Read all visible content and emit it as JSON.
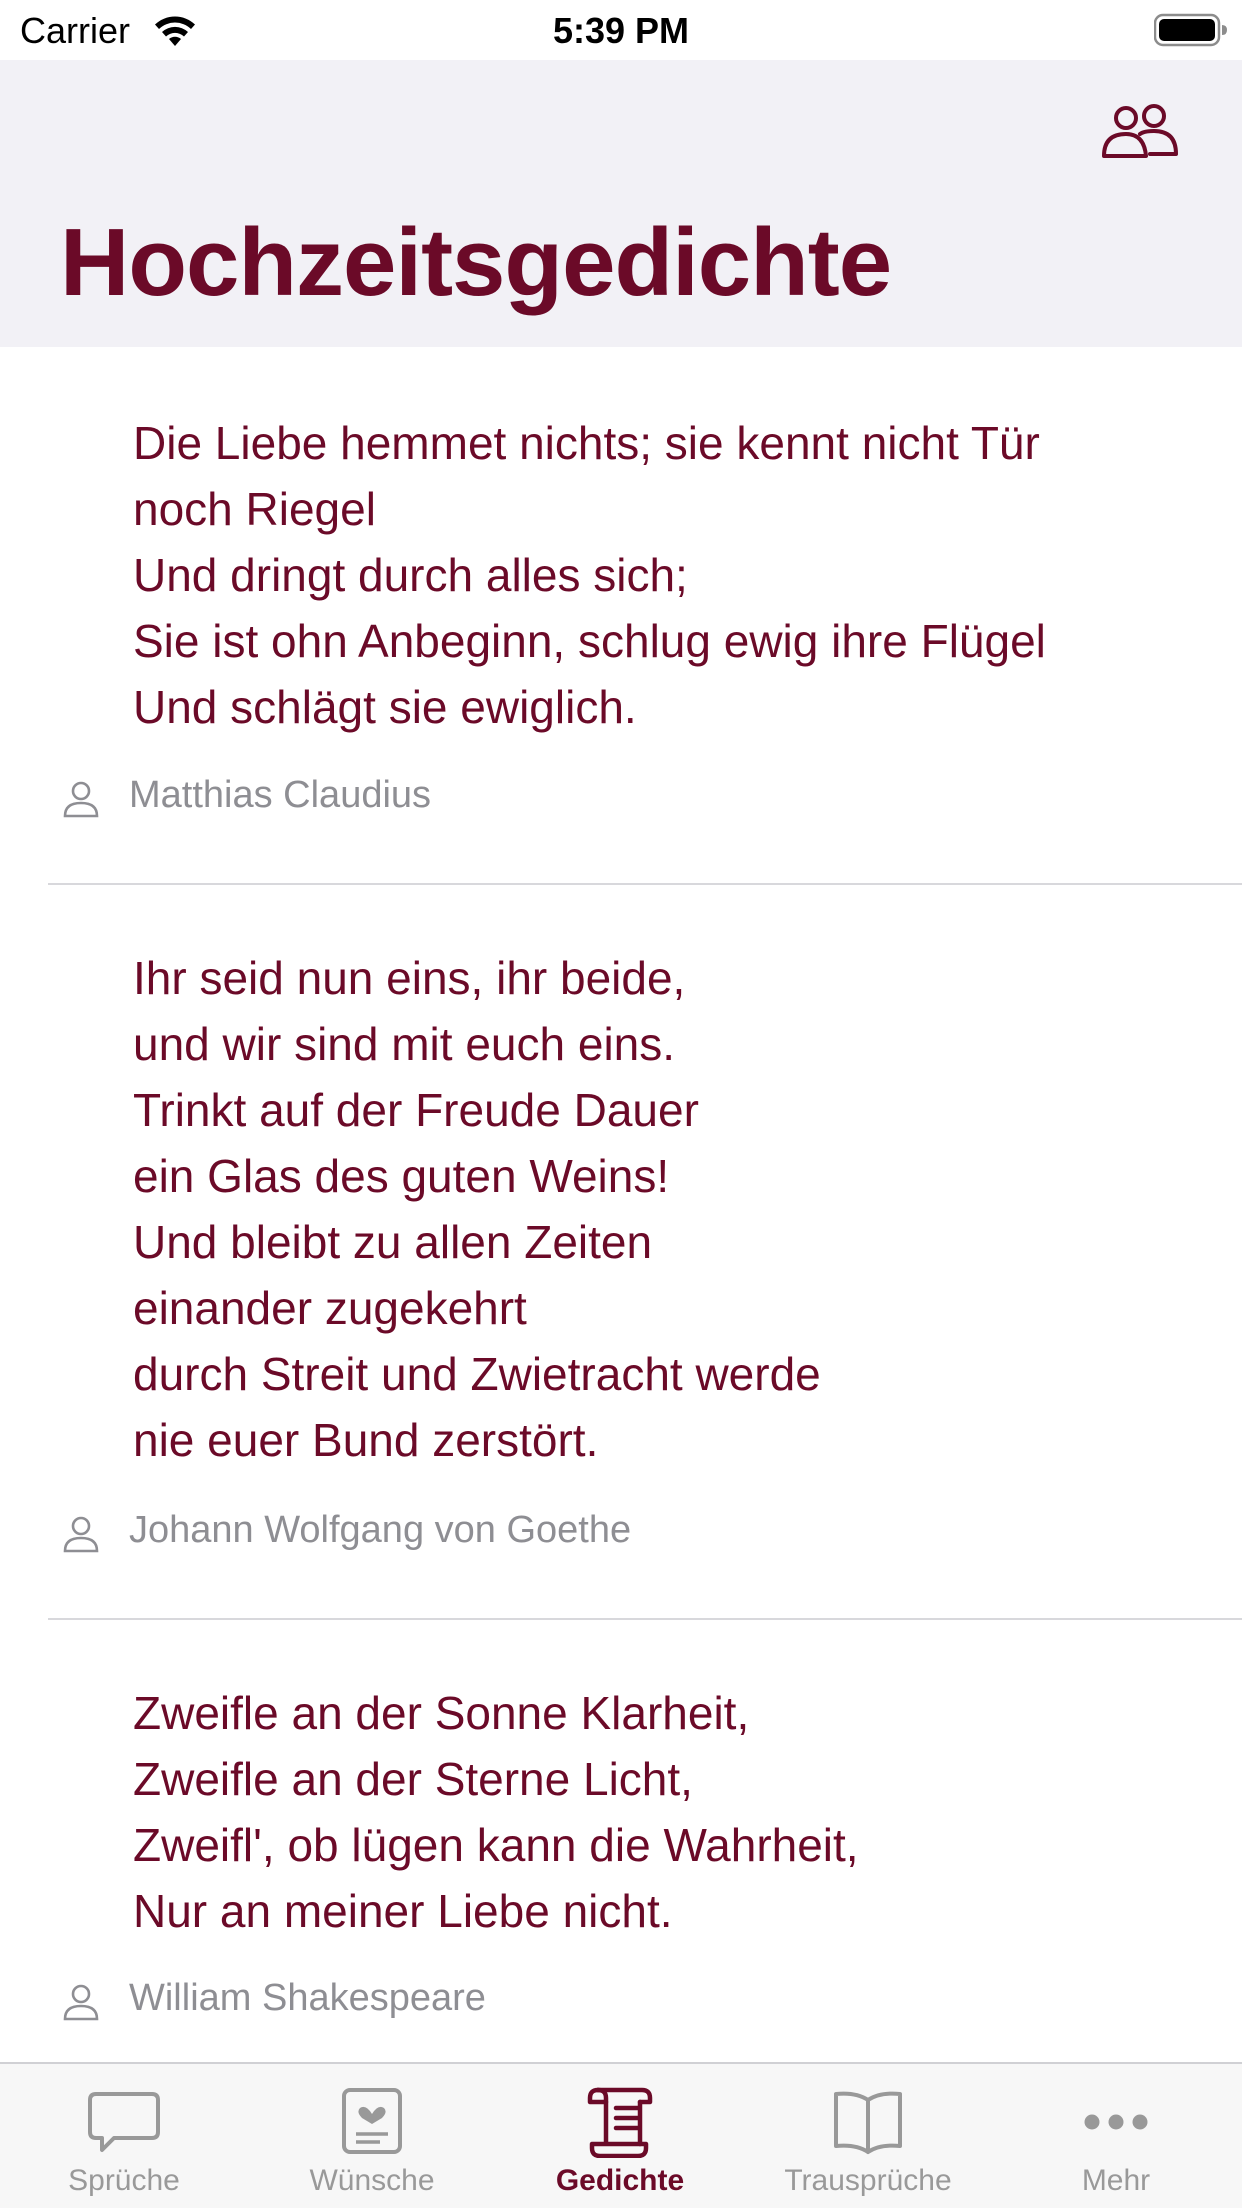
{
  "status_bar": {
    "carrier": "Carrier",
    "time": "5:39 PM"
  },
  "header": {
    "title": "Hochzeitsgedichte",
    "right_icon": "people-icon"
  },
  "poems": [
    {
      "lines": [
        "Die Liebe hemmet nichts; sie kennt nicht Tür",
        "noch Riegel",
        "Und dringt durch alles sich;",
        "Sie ist ohn Anbeginn, schlug ewig ihre Flügel",
        "Und schlägt sie ewiglich."
      ],
      "author": "Matthias Claudius"
    },
    {
      "lines": [
        "Ihr seid nun eins, ihr beide,",
        "und wir sind mit euch eins.",
        "Trinkt auf der Freude Dauer",
        "ein Glas des guten Weins!",
        "Und bleibt zu allen Zeiten",
        "einander zugekehrt",
        "durch Streit und Zwietracht werde",
        "nie euer Bund zerstört."
      ],
      "author": "Johann Wolfgang von Goethe"
    },
    {
      "lines": [
        "Zweifle an der Sonne Klarheit,",
        "Zweifle an der Sterne Licht,",
        "Zweifl', ob lügen kann die Wahrheit,",
        "Nur an meiner Liebe nicht."
      ],
      "author": "William Shakespeare"
    }
  ],
  "tab_bar": {
    "tabs": [
      {
        "label": "Sprüche",
        "icon": "speech-bubble-icon",
        "active": false
      },
      {
        "label": "Wünsche",
        "icon": "card-heart-icon",
        "active": false
      },
      {
        "label": "Gedichte",
        "icon": "scroll-icon",
        "active": true
      },
      {
        "label": "Trausprüche",
        "icon": "book-icon",
        "active": false
      },
      {
        "label": "Mehr",
        "icon": "more-icon",
        "active": false
      }
    ]
  },
  "colors": {
    "accent": "#6b0a28",
    "secondary_text": "#8e8e93",
    "header_background": "#f2f1f6",
    "tab_inactive": "#999999"
  }
}
